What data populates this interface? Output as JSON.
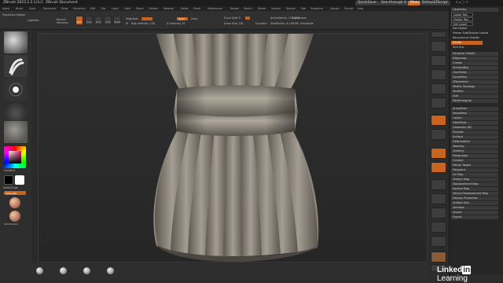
{
  "titlebar": {
    "app_title": "ZBrush 2023.2.2 [v1c]",
    "doc_title": "ZBrush Document",
    "quicksave": "QuickSave",
    "see_through": "See-through 0",
    "menus": "Menus",
    "default_script": "DefaultZScript"
  },
  "menubar": {
    "items": [
      "Alpha",
      "Brush",
      "Color",
      "Document",
      "Draw",
      "Dynamics",
      "Edit",
      "File",
      "Layer",
      "Light",
      "Macro",
      "Marker",
      "Material",
      "Movie",
      "Picker",
      "Preferences",
      "Render",
      "Stencil",
      "Stroke",
      "Surface",
      "Texture",
      "Tool",
      "Transform",
      "Zplugin",
      "Zscript",
      "Help"
    ]
  },
  "shelf": {
    "projection_master": "Projection Master",
    "lightbox": "LightBox",
    "recent_sessions": "Recent Sessions",
    "edit": "Edit",
    "draw": "Draw",
    "move": "Move",
    "scale": "Scale",
    "rotate": "Rotate",
    "mrgb": "Mrgb",
    "rgb": "Rgb",
    "m": "M",
    "rgb_intensity": "Rgb Intensity 100",
    "zadd": "Zadd",
    "zsub": "Zsub",
    "zcut": "Zcut",
    "z_intensity": "Z Intensity 25",
    "focal_shift": "Focal Shift 0",
    "draw_size": "Draw Size 128",
    "dynamic": "Dynamic",
    "active_points": "ActivePoints: 120,608",
    "total_points": "TotalPoints: 6,148 Mil",
    "dynamesh": "Dynamesh",
    "subdivide": "Subdivide"
  },
  "leftshelf": {
    "gradient": "Gradient",
    "switch_color": "SwitchColor",
    "alternate": "Alternate",
    "material_label": "SkinShade4"
  },
  "tray": {
    "items": [
      "Geometry",
      "Lower Res",
      "Higher Res",
      "Del Lower",
      "Del Higher",
      "Freeze SubDivision Levels",
      "Reconstruct Subdiv",
      "Divide",
      "Smt   Suv",
      "Dynamic Subdiv",
      "EdgeLoop",
      "Crease",
      "ShadowBox",
      "ClayPolish",
      "DynaMesh",
      "ZRemesher",
      "Modify Topology",
      "Position",
      "Size",
      "MeshIntegrity",
      "ArrayMesh",
      "NanoMesh",
      "Layers",
      "FiberMesh",
      "Geometry HD",
      "Preview",
      "Surface",
      "Deformation",
      "Masking",
      "Visibility",
      "Polygroups",
      "Contact",
      "Morph Target",
      "Polypaint",
      "UV Map",
      "Texture Map",
      "Displacement Map",
      "Normal Map",
      "Vector Displacement Map",
      "Display Properties",
      "Unified Skin",
      "Initialize",
      "Import",
      "Export"
    ]
  },
  "watermark": {
    "linked": "Linked",
    "in": "in",
    "learning": "Learning"
  },
  "colors": {
    "accent": "#c8641e",
    "background": "#2c2c2c",
    "mesh": "#8a837a"
  }
}
